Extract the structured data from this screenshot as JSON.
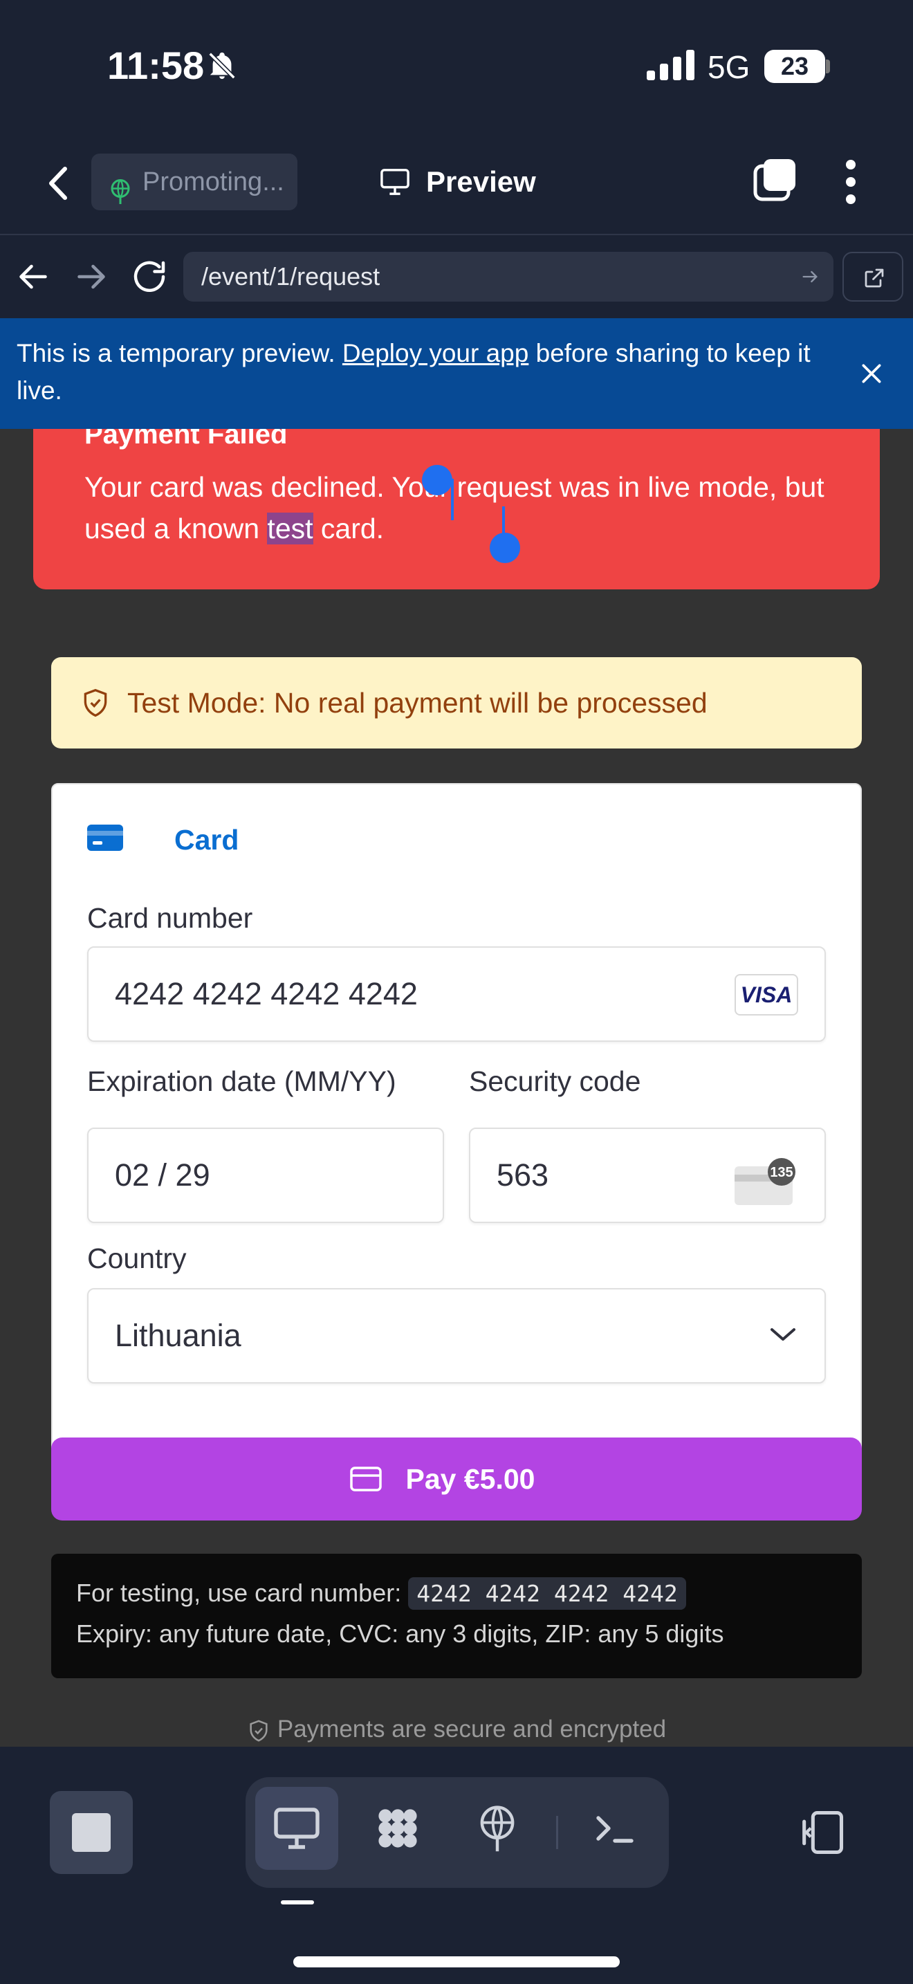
{
  "status_bar": {
    "time": "11:58",
    "network": "5G",
    "battery": "23"
  },
  "app_header": {
    "project_chip": "Promoting...",
    "preview_label": "Preview"
  },
  "browser": {
    "url": "/event/1/request"
  },
  "banner": {
    "text_before": "This is a temporary preview.",
    "link_text": "Deploy your app",
    "text_after": "before sharing to keep it live."
  },
  "error": {
    "title": "Payment Failed",
    "msg_part1": "Your card was declined. Your request was in live mode, but used a known",
    "msg_selected": "test",
    "msg_part2": "card."
  },
  "test_mode": {
    "text": "Test Mode: No real payment will be processed"
  },
  "payment_form": {
    "tab_label": "Card",
    "card_number_label": "Card number",
    "card_number_value": "4242 4242 4242 4242",
    "card_brand": "VISA",
    "expiry_label": "Expiration date (MM/YY)",
    "expiry_value": "02 / 29",
    "cvc_label": "Security code",
    "cvc_value": "563",
    "cvc_icon_text": "135",
    "country_label": "Country",
    "country_value": "Lithuania"
  },
  "pay_button": {
    "label": "Pay €5.00"
  },
  "testing_hint": {
    "line1_prefix": "For testing, use card number:",
    "card_code": "4242 4242 4242 4242",
    "line2": "Expiry: any future date, CVC: any 3 digits, ZIP: any 5 digits"
  },
  "secure_note": "Payments are secure and encrypted",
  "colors": {
    "error_red": "#ef4444",
    "pay_purple": "#b344e3",
    "banner_blue": "#074a95",
    "test_mode_bg": "#fef3c7",
    "card_blue": "#0a6ed1"
  },
  "icons": [
    "bell-slash-icon",
    "signal-icon",
    "back-icon",
    "preview-monitor-icon",
    "tabs-icon",
    "more-icon",
    "forward-icon",
    "reload-icon",
    "external-link-icon",
    "close-icon",
    "shield-check-icon",
    "credit-card-icon",
    "chevron-down-icon",
    "stop-icon",
    "monitor-icon",
    "integrations-icon",
    "deploy-icon",
    "terminal-icon",
    "panel-toggle-icon"
  ]
}
